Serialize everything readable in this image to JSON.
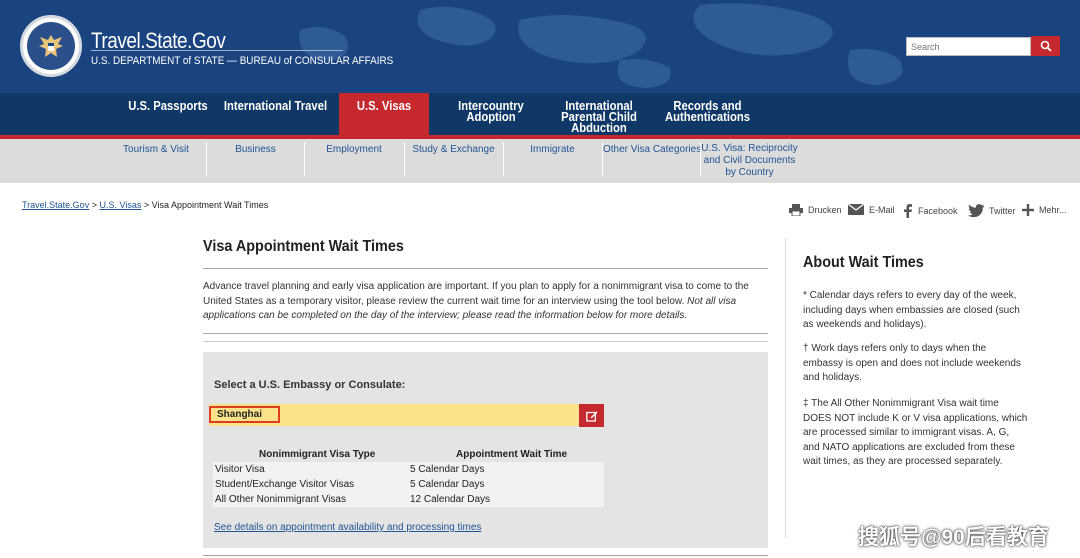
{
  "header": {
    "site_title": "Travel.State.Gov",
    "subtitle": "U.S. DEPARTMENT of STATE — BUREAU of CONSULAR AFFAIRS",
    "search_placeholder": "Search"
  },
  "nav": [
    {
      "label": "U.S. Passports",
      "active": false
    },
    {
      "label": "International Travel",
      "active": false
    },
    {
      "label": "U.S. Visas",
      "active": true
    },
    {
      "label": "Intercountry\nAdoption",
      "active": false
    },
    {
      "label": "International\nParental Child\nAbduction",
      "active": false
    },
    {
      "label": "Records and\nAuthentications",
      "active": false
    }
  ],
  "subnav": [
    "Tourism & Visit",
    "Business",
    "Employment",
    "Study & Exchange",
    "Immigrate",
    "Other Visa Categories",
    "U.S. Visa: Reciprocity\nand Civil Documents\nby Country"
  ],
  "breadcrumb": {
    "home": "Travel.State.Gov",
    "section": "U.S. Visas",
    "current": "Visa Appointment Wait Times",
    "sep": ">"
  },
  "share": {
    "print": "Drucken",
    "email": "E-Mail",
    "facebook": "Facebook",
    "twitter": "Twitter",
    "more": "Mehr..."
  },
  "main": {
    "title": "Visa Appointment Wait Times",
    "intro_text": "Advance travel planning and early visa application are important. If you plan to apply for a nonimmigrant visa to come to the United States as a temporary visitor, please review the current wait time for an interview using the tool below.",
    "intro_italic": "Not all visa applications can be completed on the day of the interview; please read the information below for more details.",
    "select_label": "Select a U.S. Embassy or Consulate:",
    "embassy_value": "Shanghai",
    "table": {
      "headers": [
        "Nonimmigrant Visa Type",
        "Appointment Wait Time"
      ],
      "rows": [
        [
          "Visitor Visa",
          "5 Calendar Days"
        ],
        [
          "Student/Exchange Visitor Visas",
          "5 Calendar Days"
        ],
        [
          "All Other Nonimmigrant Visas",
          "12 Calendar Days"
        ]
      ]
    },
    "details_link": "See details on appointment availability and processing times"
  },
  "sidebar": {
    "title": "About Wait Times",
    "notes": [
      "* Calendar days refers to every day of the week, including days when embassies are closed (such as weekends and holidays).",
      "† Work days refers only to days when the embassy is open and does not include weekends and holidays.",
      "‡ The All Other Nonimmigrant Visa wait time DOES NOT include K or V visa applications, which are processed similar to immigrant visas.  A, G, and NATO applications are excluded from these wait times, as they are processed separately."
    ]
  },
  "watermark": "搜狐号@90后看教育",
  "colors": {
    "header_blue": "#1a4480",
    "nav_blue": "#0f3866",
    "accent_red": "#c5282d",
    "subnav_gray": "#dcdcdc",
    "highlight_yellow": "#fce38a",
    "link_blue": "#205493"
  }
}
